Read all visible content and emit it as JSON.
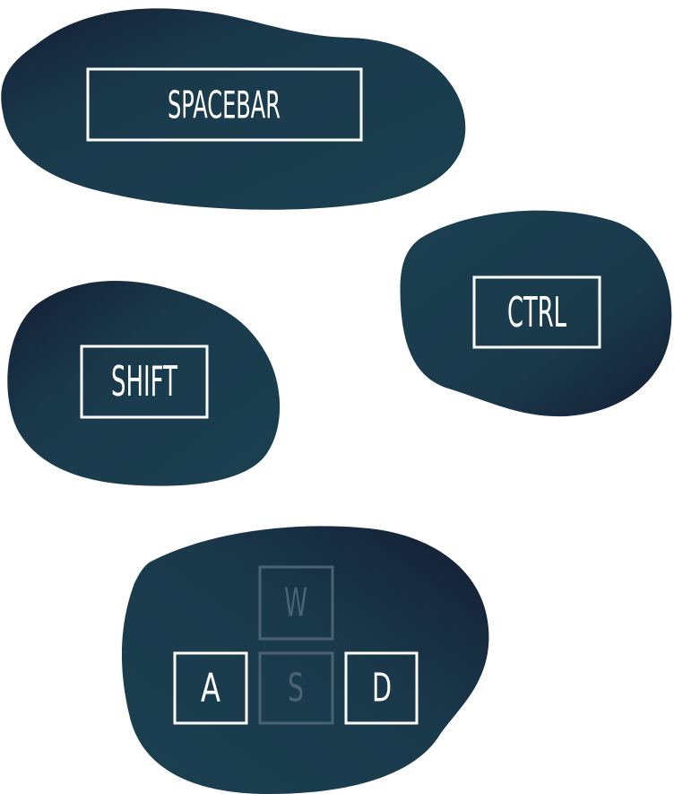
{
  "colors": {
    "blob_light": "#1a4050",
    "blob_dark": "#141d33",
    "key_stroke": "#ffffff",
    "key_stroke_dim": "#4a6272",
    "background": "#ffffff"
  },
  "keys": {
    "spacebar": {
      "label": "SPACEBAR",
      "state": "active"
    },
    "ctrl": {
      "label": "CTRL",
      "state": "active"
    },
    "shift": {
      "label": "SHIFT",
      "state": "active"
    },
    "w": {
      "label": "W",
      "state": "dim"
    },
    "a": {
      "label": "A",
      "state": "active"
    },
    "s": {
      "label": "S",
      "state": "dim"
    },
    "d": {
      "label": "D",
      "state": "active"
    }
  }
}
